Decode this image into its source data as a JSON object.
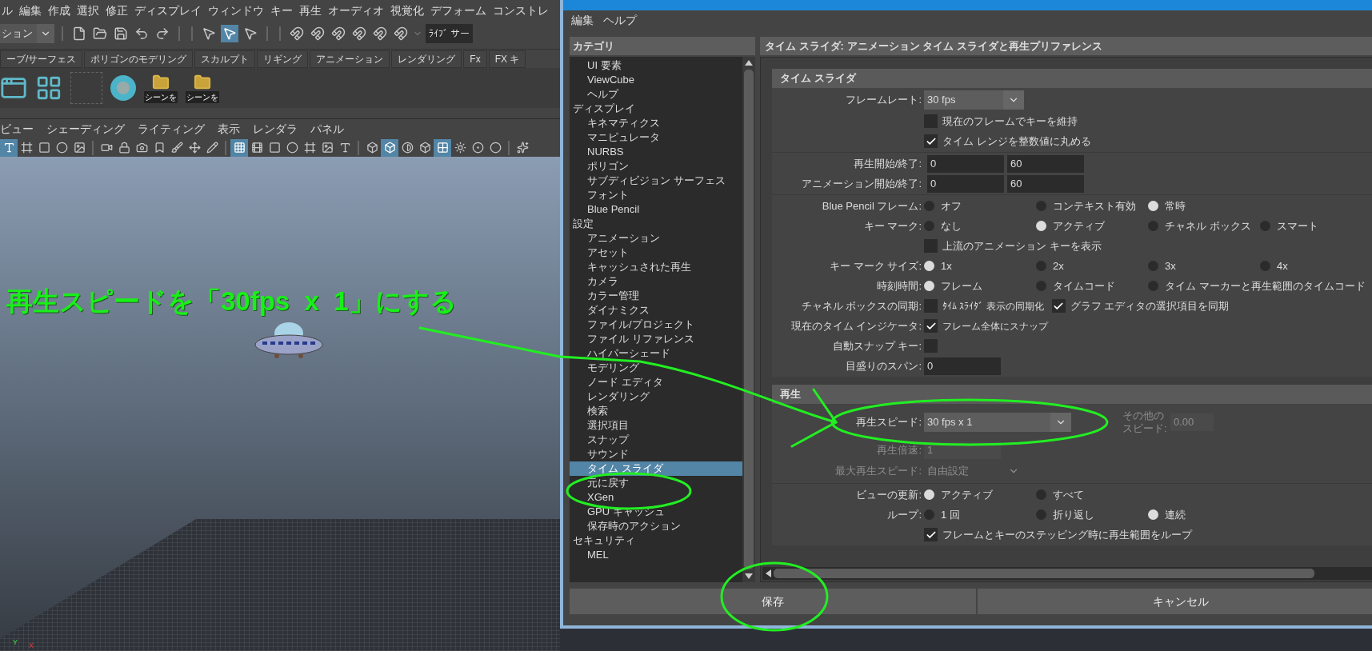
{
  "maya": {
    "menu": [
      "ル",
      "編集",
      "作成",
      "選択",
      "修正",
      "ディスプレイ",
      "ウィンドウ",
      "キー",
      "再生",
      "オーディオ",
      "視覚化",
      "デフォーム",
      "コンストレ"
    ],
    "toolbar": {
      "mode_dropdown": "ション",
      "select_tools": [
        {
          "selected": false
        },
        {
          "selected": true
        },
        {
          "selected": false
        }
      ],
      "live_field": "ﾗｲﾌﾞ サー"
    },
    "shelf_tabs": [
      {
        "label": "ーブ/サーフェス",
        "selected": false
      },
      {
        "label": "ポリゴンのモデリング",
        "selected": false
      },
      {
        "label": "スカルプト",
        "selected": false
      },
      {
        "label": "リギング",
        "selected": false
      },
      {
        "label": "アニメーション",
        "selected": false
      },
      {
        "label": "レンダリング",
        "selected": false
      },
      {
        "label": "Fx",
        "selected": false
      },
      {
        "label": "FX キ",
        "selected": false
      }
    ],
    "shelf_buttons": [
      {
        "label": "シーンを"
      },
      {
        "label": "シーンを"
      }
    ],
    "viewport_menu": [
      "ビュー",
      "シェーディング",
      "ライティング",
      "表示",
      "レンダラ",
      "パネル"
    ],
    "viewport_toolbar": [
      {
        "selected": true
      },
      {
        "selected": false
      },
      {
        "selected": false
      },
      {
        "selected": false
      },
      {
        "selected": false
      },
      {
        "selected": false
      },
      {
        "selected": false
      },
      {
        "selected": false
      },
      {
        "selected": false
      },
      {
        "selected": false
      },
      {
        "selected": false
      },
      {
        "selected": false
      },
      {
        "selected": true
      },
      {
        "selected": false
      },
      {
        "selected": false
      },
      {
        "selected": false
      },
      {
        "selected": false
      },
      {
        "selected": false
      },
      {
        "selected": false
      },
      {
        "selected": false
      },
      {
        "selected": true
      },
      {
        "selected": false
      },
      {
        "selected": false
      },
      {
        "selected": true
      },
      {
        "selected": false
      },
      {
        "selected": false
      },
      {
        "selected": false
      },
      {
        "selected": false
      }
    ],
    "axis": {
      "y": "Y",
      "x": "X"
    }
  },
  "annotation": {
    "text": "再生スピードを「30fps  x  1」にする"
  },
  "dialog": {
    "menu": [
      "編集",
      "ヘルプ"
    ],
    "category_header": "カテゴリ",
    "categories": [
      {
        "children": [
          {
            "label": "UI 要素",
            "selected": false
          },
          {
            "label": "ViewCube",
            "selected": false
          },
          {
            "label": "ヘルプ",
            "selected": false
          }
        ]
      },
      {
        "label": "ディスプレイ",
        "selected": false,
        "children": [
          {
            "label": "キネマティクス",
            "selected": false
          },
          {
            "label": "マニピュレータ",
            "selected": false
          },
          {
            "label": "NURBS",
            "selected": false
          },
          {
            "label": "ポリゴン",
            "selected": false
          },
          {
            "label": "サブディビジョン サーフェス",
            "selected": false
          },
          {
            "label": "フォント",
            "selected": false
          },
          {
            "label": "Blue Pencil",
            "selected": false
          }
        ]
      },
      {
        "label": "設定",
        "selected": false,
        "children": [
          {
            "label": "アニメーション",
            "selected": false
          },
          {
            "label": "アセット",
            "selected": false
          },
          {
            "label": "キャッシュされた再生",
            "selected": false
          },
          {
            "label": "カメラ",
            "selected": false
          },
          {
            "label": "カラー管理",
            "selected": false
          },
          {
            "label": "ダイナミクス",
            "selected": false
          },
          {
            "label": "ファイル/プロジェクト",
            "selected": false
          },
          {
            "label": "ファイル リファレンス",
            "selected": false
          },
          {
            "label": "ハイパーシェード",
            "selected": false
          },
          {
            "label": "モデリング",
            "selected": false
          },
          {
            "label": "ノード エディタ",
            "selected": false
          },
          {
            "label": "レンダリング",
            "selected": false
          },
          {
            "label": "検索",
            "selected": false
          },
          {
            "label": "選択項目",
            "selected": false
          },
          {
            "label": "スナップ",
            "selected": false
          },
          {
            "label": "サウンド",
            "selected": false
          },
          {
            "label": "タイム スライダ",
            "selected": true
          },
          {
            "label": "元に戻す",
            "selected": false
          },
          {
            "label": "XGen",
            "selected": false
          },
          {
            "label": "GPU キャッシュ",
            "selected": false
          },
          {
            "label": "保存時のアクション",
            "selected": false
          }
        ]
      },
      {
        "label": "セキュリティ",
        "selected": false,
        "children": [
          {
            "label": "MEL",
            "selected": false
          }
        ]
      }
    ],
    "panel_title": "タイム スライダ: アニメーション タイム スライダと再生プリファレンス",
    "sections": [
      {
        "title": "タイム スライダ",
        "groups": [
          {
            "rows": [
              {
                "kind": "dropdown",
                "label": "フレームレート:",
                "value": "30 fps",
                "disabled": false
              },
              {
                "kind": "checkbox",
                "text": "現在のフレームでキーを維持",
                "checked": false
              },
              {
                "kind": "checkbox",
                "text": "タイム レンジを整数値に丸める",
                "checked": true
              }
            ]
          },
          {
            "rows": [
              {
                "kind": "range",
                "label": "再生開始/終了:",
                "values": [
                  "0",
                  "60"
                ]
              },
              {
                "kind": "range",
                "label": "アニメーション開始/終了:",
                "values": [
                  "0",
                  "60"
                ]
              }
            ]
          },
          {
            "rows": [
              {
                "kind": "radio",
                "label": "Blue Pencil フレーム:",
                "options": [
                  {
                    "text": "オフ",
                    "selected": false
                  },
                  {
                    "text": "コンテキスト有効",
                    "selected": false
                  },
                  {
                    "text": "常時",
                    "selected": true
                  }
                ]
              },
              {
                "kind": "radio",
                "label": "キー マーク:",
                "options": [
                  {
                    "text": "なし",
                    "selected": false
                  },
                  {
                    "text": "アクティブ",
                    "selected": true
                  },
                  {
                    "text": "チャネル ボックス",
                    "selected": false
                  },
                  {
                    "text": "スマート",
                    "selected": false
                  }
                ]
              },
              {
                "kind": "checkbox",
                "text": "上流のアニメーション キーを表示",
                "checked": false
              },
              {
                "kind": "radio",
                "label": "キー マーク サイズ:",
                "options": [
                  {
                    "text": "1x",
                    "selected": true
                  },
                  {
                    "text": "2x",
                    "selected": false
                  },
                  {
                    "text": "3x",
                    "selected": false
                  },
                  {
                    "text": "4x",
                    "selected": false
                  }
                ]
              },
              {
                "kind": "radio",
                "label": "時刻時間:",
                "options": [
                  {
                    "text": "フレーム",
                    "selected": true
                  },
                  {
                    "text": "タイムコード",
                    "selected": false
                  },
                  {
                    "text": "タイム マーカーと再生範囲のタイムコード",
                    "selected": false
                  }
                ]
              },
              {
                "kind": "checks",
                "label": "チャネル ボックスの同期:",
                "items": [
                  {
                    "text": "ﾀｲﾑ ｽﾗｲﾀﾞ 表示の同期化",
                    "checked": false
                  },
                  {
                    "text": "グラフ エディタの選択項目を同期",
                    "checked": true
                  }
                ]
              },
              {
                "kind": "checks",
                "label": "現在のタイム インジケータ:",
                "items": [
                  {
                    "text": "フレーム全体にスナップ",
                    "checked": true
                  }
                ]
              },
              {
                "kind": "checks",
                "label": "自動スナップ キー:",
                "items": [
                  {
                    "checked": false
                  }
                ]
              },
              {
                "kind": "field",
                "label": "目盛りのスパン:",
                "value": "0",
                "disabled": false
              }
            ]
          }
        ]
      },
      {
        "title": "再生",
        "groups": [
          {
            "rows": [
              {
                "kind": "dropdown",
                "label": "再生スピード:",
                "value": "30 fps x 1",
                "disabled": false,
                "side_field": {
                  "label": "その他のスピード:",
                  "value": "0.00",
                  "disabled": true
                }
              },
              {
                "kind": "field",
                "label": "再生倍速:",
                "value": "1",
                "disabled": true
              },
              {
                "kind": "dropdown",
                "label": "最大再生スピード:",
                "value": "自由設定",
                "disabled": true
              }
            ]
          },
          {
            "rows": [
              {
                "kind": "radio",
                "label": "ビューの更新:",
                "options": [
                  {
                    "text": "アクティブ",
                    "selected": true
                  },
                  {
                    "text": "すべて",
                    "selected": false
                  }
                ]
              },
              {
                "kind": "radio",
                "label": "ループ:",
                "options": [
                  {
                    "text": "1 回",
                    "selected": false
                  },
                  {
                    "text": "折り返し",
                    "selected": false
                  },
                  {
                    "text": "連続",
                    "selected": true
                  }
                ]
              },
              {
                "kind": "checkbox",
                "text": "フレームとキーのステッピング時に再生範囲をループ",
                "checked": true
              }
            ]
          }
        ]
      }
    ],
    "buttons": [
      "保存",
      "キャンセル"
    ]
  }
}
